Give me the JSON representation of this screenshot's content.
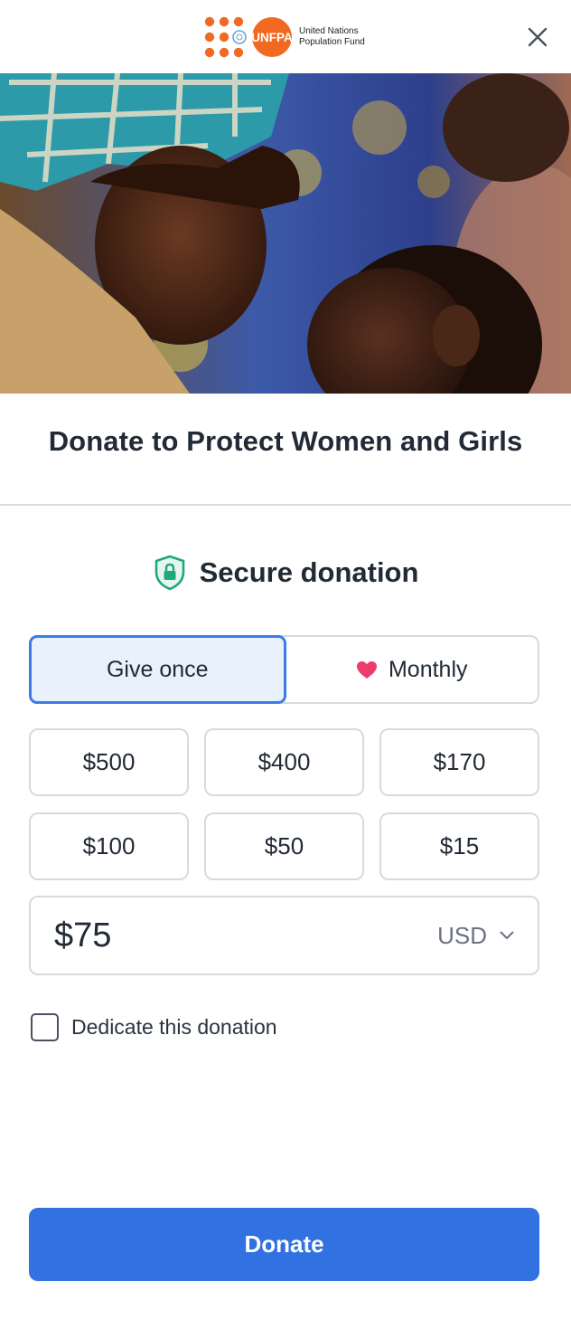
{
  "header": {
    "logo_abbr": "UNFPA",
    "logo_line1": "United Nations",
    "logo_line2": "Population Fund",
    "close_icon": "close-icon",
    "brand_color": "#f26a21"
  },
  "hero": {
    "image": "photo-woman-and-child"
  },
  "title": "Donate to Protect Women and Girls",
  "secure": {
    "label": "Secure donation",
    "icon": "shield-lock-icon",
    "icon_color": "#1ea97c"
  },
  "frequency": {
    "options": [
      {
        "label": "Give once",
        "selected": true
      },
      {
        "label": "Monthly",
        "selected": false,
        "icon": "heart-icon"
      }
    ],
    "accent": "#3d7be6",
    "heart_color": "#ee3d6d"
  },
  "amounts": [
    "$500",
    "$400",
    "$170",
    "$100",
    "$50",
    "$15"
  ],
  "custom_amount": {
    "value": "$75",
    "currency": "USD",
    "currency_icon": "chevron-down-icon"
  },
  "dedicate": {
    "label": "Dedicate this donation",
    "checked": false
  },
  "donate_button": {
    "label": "Donate",
    "color": "#3271e2"
  }
}
